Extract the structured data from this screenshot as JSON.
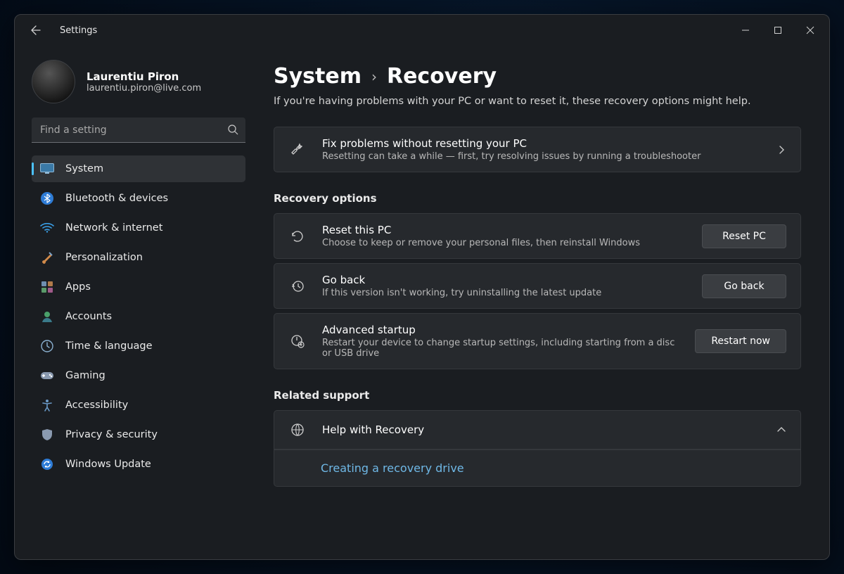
{
  "window": {
    "title": "Settings"
  },
  "user": {
    "name": "Laurentiu Piron",
    "email": "laurentiu.piron@live.com"
  },
  "search": {
    "placeholder": "Find a setting"
  },
  "nav": {
    "items": [
      {
        "label": "System",
        "active": true
      },
      {
        "label": "Bluetooth & devices",
        "active": false
      },
      {
        "label": "Network & internet",
        "active": false
      },
      {
        "label": "Personalization",
        "active": false
      },
      {
        "label": "Apps",
        "active": false
      },
      {
        "label": "Accounts",
        "active": false
      },
      {
        "label": "Time & language",
        "active": false
      },
      {
        "label": "Gaming",
        "active": false
      },
      {
        "label": "Accessibility",
        "active": false
      },
      {
        "label": "Privacy & security",
        "active": false
      },
      {
        "label": "Windows Update",
        "active": false
      }
    ]
  },
  "breadcrumb": {
    "root": "System",
    "current": "Recovery"
  },
  "subtitle": "If you're having problems with your PC or want to reset it, these recovery options might help.",
  "fix_card": {
    "title": "Fix problems without resetting your PC",
    "desc": "Resetting can take a while — first, try resolving issues by running a troubleshooter"
  },
  "sections": {
    "recovery_options": "Recovery options",
    "related_support": "Related support"
  },
  "reset_card": {
    "title": "Reset this PC",
    "desc": "Choose to keep or remove your personal files, then reinstall Windows",
    "button": "Reset PC"
  },
  "goback_card": {
    "title": "Go back",
    "desc": "If this version isn't working, try uninstalling the latest update",
    "button": "Go back"
  },
  "advanced_card": {
    "title": "Advanced startup",
    "desc": "Restart your device to change startup settings, including starting from a disc or USB drive",
    "button": "Restart now"
  },
  "help_card": {
    "title": "Help with Recovery"
  },
  "help_sub_link": "Creating a recovery drive"
}
